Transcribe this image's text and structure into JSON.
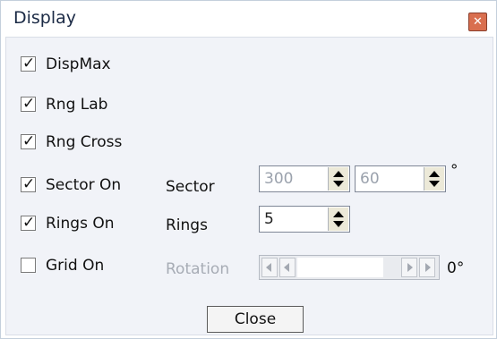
{
  "window": {
    "title": "Display",
    "close_icon": "close-icon"
  },
  "checkboxes": [
    {
      "label": "DispMax",
      "checked": true
    },
    {
      "label": "Rng Lab",
      "checked": true
    },
    {
      "label": "Rng Cross",
      "checked": true
    },
    {
      "label": "Sector On",
      "checked": true
    },
    {
      "label": "Rings On",
      "checked": true
    },
    {
      "label": "Grid On",
      "checked": false
    }
  ],
  "sector": {
    "label": "Sector",
    "value1": "300",
    "value2": "60",
    "unit": "°"
  },
  "rings": {
    "label": "Rings",
    "value": "5"
  },
  "rotation": {
    "label": "Rotation",
    "value_text": "0°",
    "enabled": false
  },
  "buttons": {
    "close": "Close"
  },
  "colors": {
    "title_text": "#1b2a45",
    "close_x": "#d96f4f",
    "disabled_text": "#a7acb5"
  }
}
